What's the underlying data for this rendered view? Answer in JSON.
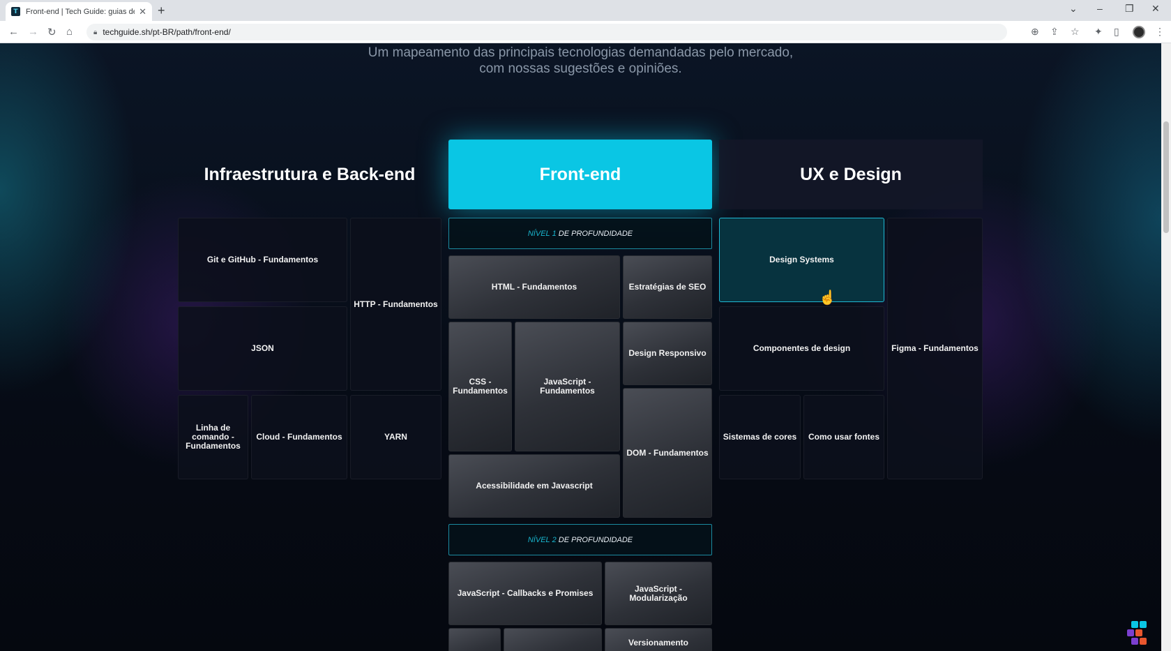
{
  "browser": {
    "tab_title": "Front-end | Tech Guide: guias de",
    "favicon_letter": "T",
    "url": "techguide.sh/pt-BR/path/front-end/"
  },
  "page": {
    "subtitle_line1": "Um mapeamento das principais tecnologias demandadas pelo mercado,",
    "subtitle_line2": "com nossas sugestões e opiniões.",
    "columns": {
      "left": "Infraestrutura e Back-end",
      "middle": "Front-end",
      "right": "UX e Design"
    },
    "levels": {
      "level1_word": "NÍVEL",
      "level1_num": "1",
      "level1_rest": "DE PROFUNDIDADE",
      "level2_word": "NÍVEL",
      "level2_num": "2",
      "level2_rest": "DE PROFUNDIDADE"
    },
    "infra": {
      "git": "Git e GitHub - Fundamentos",
      "http": "HTTP - Fundamentos",
      "json": "JSON",
      "cli": "Linha de comando - Fundamentos",
      "cloud": "Cloud - Fundamentos",
      "yarn": "YARN"
    },
    "frontend": {
      "html": "HTML - Fundamentos",
      "seo": "Estratégias de SEO",
      "css": "CSS - Fundamentos",
      "js": "JavaScript - Fundamentos",
      "responsive": "Design Responsivo",
      "dom": "DOM - Fundamentos",
      "a11y": "Acessibilidade em Javascript",
      "callbacks": "JavaScript - Callbacks e Promises",
      "modules": "JavaScript - Modularização",
      "versioning": "Versionamento"
    },
    "ux": {
      "design_systems": "Design Systems",
      "components": "Componentes de design",
      "figma": "Figma - Fundamentos",
      "colors": "Sistemas de cores",
      "fonts": "Como usar fontes"
    }
  },
  "colors": {
    "accent": "#0ac6e4",
    "selected_bg": "#07333f",
    "selected_border": "#1fb9d4"
  },
  "icons": [
    "back-icon",
    "forward-icon",
    "reload-icon",
    "home-icon",
    "lock-icon",
    "zoom-icon",
    "share-icon",
    "star-icon",
    "extensions-icon",
    "sidebar-icon",
    "menu-icon"
  ]
}
